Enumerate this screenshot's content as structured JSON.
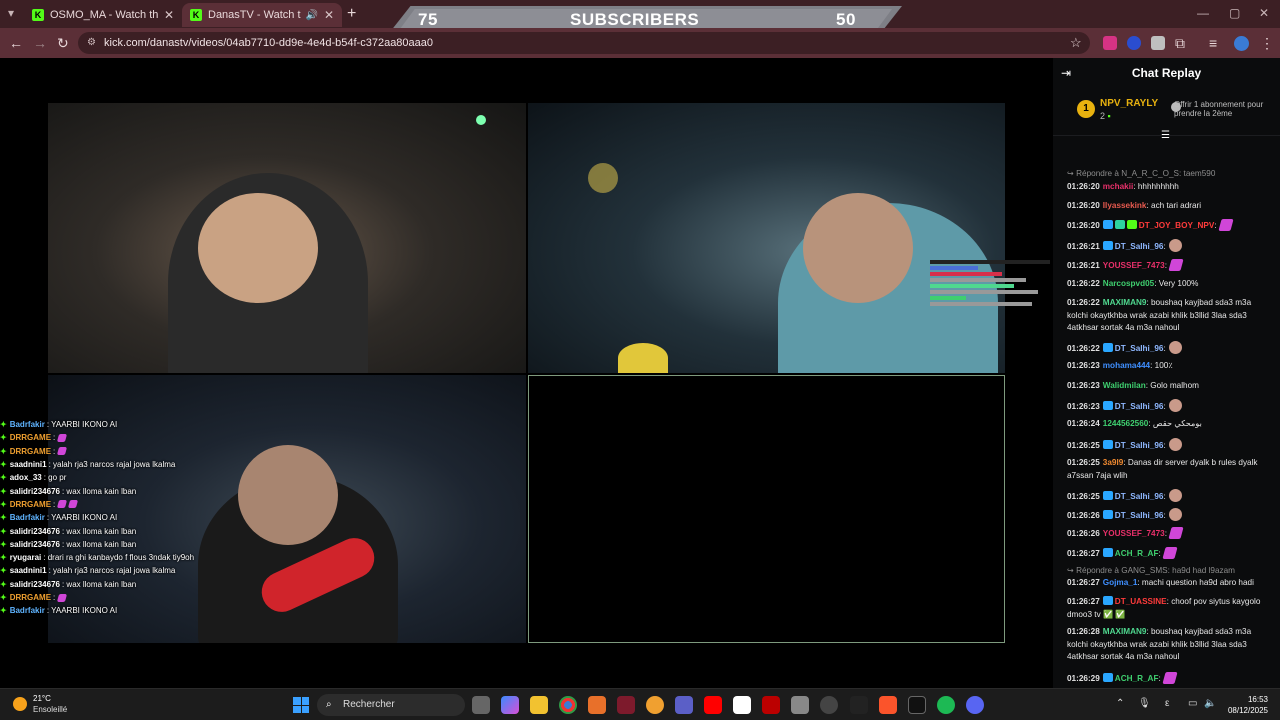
{
  "browser": {
    "tabs": [
      {
        "title": "OSMO_MA - Watch the VOD o",
        "active": false
      },
      {
        "title": "DanasTV - Watch the VOD o",
        "active": true
      }
    ],
    "url": "kick.com/danastv/videos/04ab7710-dd9e-4e4d-b54f-c372aa80aaa0"
  },
  "subscribers_bar": {
    "left": "75",
    "label": "SUBSCRIBERS",
    "right": "50"
  },
  "overlay_chat": [
    {
      "user": "Badrfakir",
      "color": "#5fb4ff",
      "text": ": YAARBI IKONO AI",
      "emotes": 0
    },
    {
      "user": "DRRGAME",
      "color": "#f0a030",
      "text": ":",
      "emotes": 1
    },
    {
      "user": "DRRGAME",
      "color": "#f0a030",
      "text": ":",
      "emotes": 1
    },
    {
      "user": "saadnini1",
      "color": "#ffffff",
      "text": ": yalah rja3 narcos rajal jowa lkalma",
      "emotes": 0
    },
    {
      "user": "adox_33",
      "color": "#ffffff",
      "text": ": go pr",
      "emotes": 0
    },
    {
      "user": "salidri234676",
      "color": "#ffffff",
      "text": ": wax lloma kain lban",
      "emotes": 0
    },
    {
      "user": "DRRGAME",
      "color": "#f0a030",
      "text": ":",
      "emotes": 2
    },
    {
      "user": "Badrfakir",
      "color": "#5fb4ff",
      "text": ": YAARBI IKONO AI",
      "emotes": 0
    },
    {
      "user": "salidri234676",
      "color": "#ffffff",
      "text": ": wax lloma kain lban",
      "emotes": 0
    },
    {
      "user": "salidri234676",
      "color": "#ffffff",
      "text": ": wax lloma kain lban",
      "emotes": 0
    },
    {
      "user": "ryugarai",
      "color": "#ffffff",
      "text": ": drari ra ghi kanbaydo f flous 3ndak tiy9oh",
      "emotes": 0
    },
    {
      "user": "saadnini1",
      "color": "#ffffff",
      "text": ": yalah rja3 narcos rajal jowa lkalma",
      "emotes": 0
    },
    {
      "user": "salidri234676",
      "color": "#ffffff",
      "text": ": wax lloma kain lban",
      "emotes": 0
    },
    {
      "user": "DRRGAME",
      "color": "#f0a030",
      "text": ":",
      "emotes": 1
    },
    {
      "user": "Badrfakir",
      "color": "#5fb4ff",
      "text": ": YAARBI IKONO AI",
      "emotes": 0
    }
  ],
  "chat": {
    "title": "Chat Replay",
    "pinned": {
      "name": "NPV_RAYLY",
      "rank": "1",
      "count": "2",
      "offer": "Offrir 1 abonnement pour prendre la 2ème"
    },
    "messages": [
      {
        "type": "reply",
        "text": "Répondre à N_A_R_C_O_S: taem590"
      },
      {
        "ts": "01:26:20",
        "user": "mchakii",
        "color": "#e8306a",
        "text": ": hhhhhhhhh"
      },
      {
        "ts": "01:26:20",
        "user": "Ilyassekink",
        "color": "#e85a4f",
        "text": ": ach tari adrari"
      },
      {
        "ts": "01:26:20",
        "user": "DT_JOY_BOY_NPV",
        "color": "#ff3b3b",
        "text": ":",
        "badges": 3,
        "emote": "em"
      },
      {
        "ts": "01:26:21",
        "user": "DT_Salhi_96",
        "color": "#8fb8ff",
        "text": ":",
        "badges": 1,
        "emote": "av"
      },
      {
        "ts": "01:26:21",
        "user": "YOUSSEF_7473",
        "color": "#e8306a",
        "text": ":",
        "emote": "em"
      },
      {
        "ts": "01:26:22",
        "user": "Narcospvd05",
        "color": "#3fcf6f",
        "text": ": Very 100%"
      },
      {
        "ts": "01:26:22",
        "user": "MAXIMAN9",
        "color": "#4fd88f",
        "text": ": boushaq kayjbad sda3 m3a kolchi okaytkhba wrak azabi khlik b3llid 3laa sda3 4atkhsar sortak 4a m3a nahoul"
      },
      {
        "ts": "01:26:22",
        "user": "DT_Salhi_96",
        "color": "#8fb8ff",
        "text": ":",
        "badges": 1,
        "emote": "av"
      },
      {
        "ts": "01:26:23",
        "user": "mohama444",
        "color": "#3f8fff",
        "text": ": 100٪"
      },
      {
        "ts": "01:26:23",
        "user": "Walidmilan",
        "color": "#3fcf6f",
        "text": ": Golo malhom"
      },
      {
        "ts": "01:26:23",
        "user": "DT_Salhi_96",
        "color": "#8fb8ff",
        "text": ":",
        "badges": 1,
        "emote": "av"
      },
      {
        "ts": "01:26:24",
        "user": "1244562560",
        "color": "#3fcf6f",
        "text": ": بومحكي حقص"
      },
      {
        "ts": "01:26:25",
        "user": "DT_Salhi_96",
        "color": "#8fb8ff",
        "text": ":",
        "badges": 1,
        "emote": "av"
      },
      {
        "ts": "01:26:25",
        "user": "3a9l9",
        "color": "#f08a30",
        "text": ": Danas dir server dyalk b rules dyalk a7ssan 7aja wlih"
      },
      {
        "ts": "01:26:25",
        "user": "DT_Salhi_96",
        "color": "#8fb8ff",
        "text": ":",
        "badges": 1,
        "emote": "av"
      },
      {
        "ts": "01:26:26",
        "user": "DT_Salhi_96",
        "color": "#8fb8ff",
        "text": ":",
        "badges": 1,
        "emote": "av"
      },
      {
        "ts": "01:26:26",
        "user": "YOUSSEF_7473",
        "color": "#e8306a",
        "text": ":",
        "emote": "em"
      },
      {
        "ts": "01:26:27",
        "user": "ACH_R_AF",
        "color": "#3fcf6f",
        "text": ":",
        "badges": 1,
        "emote": "em"
      },
      {
        "type": "reply",
        "text": "Répondre à GANG_SMS: ha9d had l9azam"
      },
      {
        "ts": "01:26:27",
        "user": "Gojma_1",
        "color": "#3f8fff",
        "text": ": machi question ha9d abro hadi"
      },
      {
        "ts": "01:26:27",
        "user": "DT_UASSINE",
        "color": "#ff3b3b",
        "text": ": choof pov siytus kaygolo dmoo3 tv ✅ ✅",
        "badges": 1
      },
      {
        "ts": "01:26:28",
        "user": "MAXIMAN9",
        "color": "#4fd88f",
        "text": ": boushaq kayjbad sda3 m3a kolchi okaytkhba wrak azabi khlik b3llid 3laa sda3 4atkhsar sortak 4a m3a nahoul"
      },
      {
        "ts": "01:26:29",
        "user": "ACH_R_AF",
        "color": "#3fcf6f",
        "text": ":",
        "badges": 1,
        "emote": "em"
      }
    ]
  },
  "taskbar": {
    "weather_temp": "21°C",
    "weather_desc": "Ensoleillé",
    "search_label": "Rechercher",
    "lang": "ε",
    "time": "16:53",
    "date": "08/12/2025"
  },
  "colors": {
    "kick_green": "#53fc18",
    "tabbar": "#3c1f24",
    "addrbar": "#5b2f37",
    "chat_bg": "#0b0c0d"
  }
}
